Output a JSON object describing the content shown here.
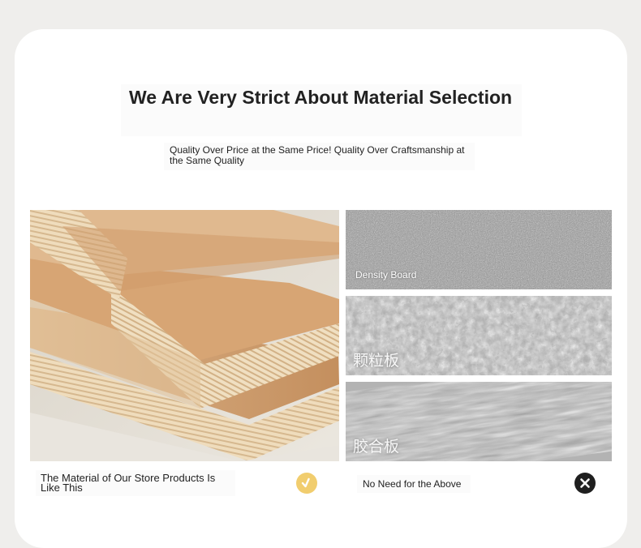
{
  "header": {
    "title": "We Are Very Strict About Material Selection",
    "subtitle": "Quality Over Price at the Same Price! Quality Over Craftsmanship at the Same Quality"
  },
  "materials": [
    {
      "label": "Density Board",
      "texture": "fine-grain"
    },
    {
      "label": "颗粒板",
      "texture": "chips"
    },
    {
      "label": "胶合板",
      "texture": "strands"
    }
  ],
  "comparison": {
    "ours_caption": "The Material of Our Store Products Is Like This",
    "ours_icon": "check-icon",
    "others_caption": "No Need for the Above",
    "others_icon": "close-icon"
  },
  "colors": {
    "check": "#f1cd6e",
    "cross": "#1f1f1f",
    "plywood": "#e8c9a0"
  }
}
